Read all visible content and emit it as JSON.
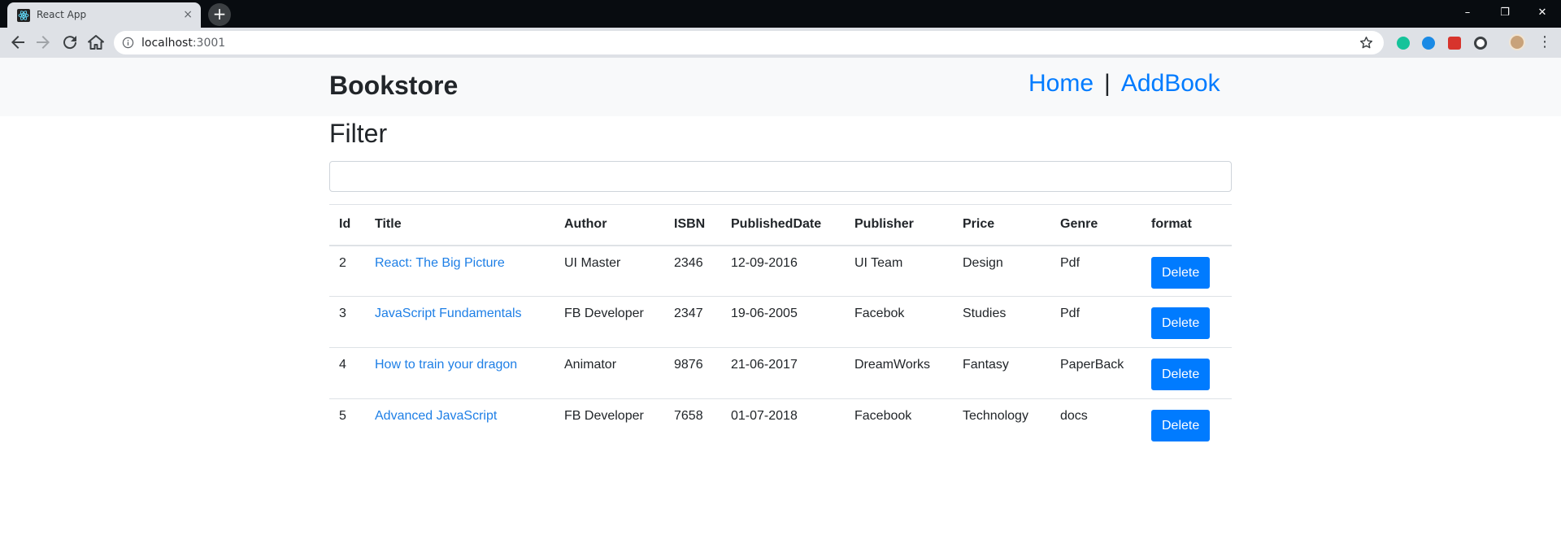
{
  "browser": {
    "tab_title": "React App",
    "tab_close": "×",
    "new_tab": "+",
    "url_host": "localhost",
    "url_port": ":3001",
    "window_controls": {
      "minimize": "–",
      "restore": "❐",
      "close": "✕"
    }
  },
  "navbar": {
    "brand": "Bookstore",
    "links": {
      "home": "Home",
      "separator": "|",
      "add_book": "AddBook"
    }
  },
  "filter": {
    "title": "Filter",
    "value": "",
    "placeholder": ""
  },
  "table": {
    "headers": {
      "id": "Id",
      "title": "Title",
      "author": "Author",
      "isbn": "ISBN",
      "published_date": "PublishedDate",
      "publisher": "Publisher",
      "price": "Price",
      "genre": "Genre",
      "format": "format"
    },
    "rows": [
      {
        "id": "2",
        "title": "React: The Big Picture",
        "author": "UI Master",
        "isbn": "2346",
        "published_date": "12-09-2016",
        "publisher": "UI Team",
        "price": "Design",
        "genre": "Pdf",
        "action": "Delete"
      },
      {
        "id": "3",
        "title": "JavaScript Fundamentals",
        "author": "FB Developer",
        "isbn": "2347",
        "published_date": "19-06-2005",
        "publisher": "Facebok",
        "price": "Studies",
        "genre": "Pdf",
        "action": "Delete"
      },
      {
        "id": "4",
        "title": "How to train your dragon",
        "author": "Animator",
        "isbn": "9876",
        "published_date": "21-06-2017",
        "publisher": "DreamWorks",
        "price": "Fantasy",
        "genre": "PaperBack",
        "action": "Delete"
      },
      {
        "id": "5",
        "title": "Advanced JavaScript",
        "author": "FB Developer",
        "isbn": "7658",
        "published_date": "01-07-2018",
        "publisher": "Facebook",
        "price": "Technology",
        "genre": "docs",
        "action": "Delete"
      }
    ]
  },
  "colors": {
    "link": "#007bff",
    "button": "#007bff",
    "navbar_bg": "#f8f9fa"
  }
}
